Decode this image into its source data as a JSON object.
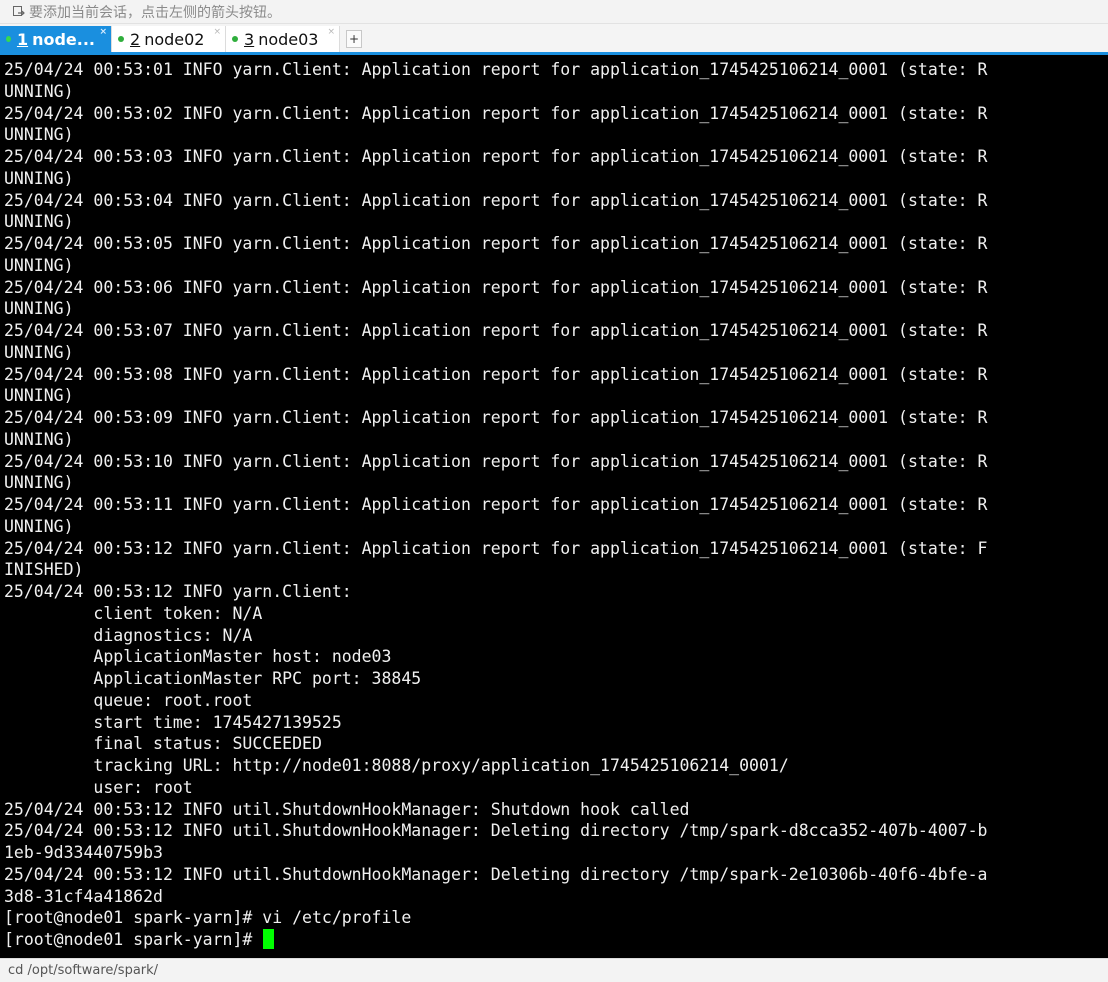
{
  "hint_bar": {
    "icon": "arrow-icon",
    "text": "要添加当前会话，点击左侧的箭头按钮。"
  },
  "tabs": [
    {
      "number": "1",
      "label": "node...",
      "status_color": "#36d94f",
      "active": true
    },
    {
      "number": "2",
      "label": "node02",
      "status_color": "#2fae3c",
      "active": false
    },
    {
      "number": "3",
      "label": "node03",
      "status_color": "#2fae3c",
      "active": false
    }
  ],
  "add_tab_label": "+",
  "terminal": {
    "lines": [
      "25/04/24 00:53:01 INFO yarn.Client: Application report for application_1745425106214_0001 (state: R",
      "UNNING)",
      "25/04/24 00:53:02 INFO yarn.Client: Application report for application_1745425106214_0001 (state: R",
      "UNNING)",
      "25/04/24 00:53:03 INFO yarn.Client: Application report for application_1745425106214_0001 (state: R",
      "UNNING)",
      "25/04/24 00:53:04 INFO yarn.Client: Application report for application_1745425106214_0001 (state: R",
      "UNNING)",
      "25/04/24 00:53:05 INFO yarn.Client: Application report for application_1745425106214_0001 (state: R",
      "UNNING)",
      "25/04/24 00:53:06 INFO yarn.Client: Application report for application_1745425106214_0001 (state: R",
      "UNNING)",
      "25/04/24 00:53:07 INFO yarn.Client: Application report for application_1745425106214_0001 (state: R",
      "UNNING)",
      "25/04/24 00:53:08 INFO yarn.Client: Application report for application_1745425106214_0001 (state: R",
      "UNNING)",
      "25/04/24 00:53:09 INFO yarn.Client: Application report for application_1745425106214_0001 (state: R",
      "UNNING)",
      "25/04/24 00:53:10 INFO yarn.Client: Application report for application_1745425106214_0001 (state: R",
      "UNNING)",
      "25/04/24 00:53:11 INFO yarn.Client: Application report for application_1745425106214_0001 (state: R",
      "UNNING)",
      "25/04/24 00:53:12 INFO yarn.Client: Application report for application_1745425106214_0001 (state: F",
      "INISHED)",
      "25/04/24 00:53:12 INFO yarn.Client: ",
      "\t client token: N/A",
      "\t diagnostics: N/A",
      "\t ApplicationMaster host: node03",
      "\t ApplicationMaster RPC port: 38845",
      "\t queue: root.root",
      "\t start time: 1745427139525",
      "\t final status: SUCCEEDED",
      "\t tracking URL: http://node01:8088/proxy/application_1745425106214_0001/",
      "\t user: root",
      "25/04/24 00:53:12 INFO util.ShutdownHookManager: Shutdown hook called",
      "25/04/24 00:53:12 INFO util.ShutdownHookManager: Deleting directory /tmp/spark-d8cca352-407b-4007-b",
      "1eb-9d33440759b3",
      "25/04/24 00:53:12 INFO util.ShutdownHookManager: Deleting directory /tmp/spark-2e10306b-40f6-4bfe-a",
      "3d8-31cf4a41862d",
      "[root@node01 spark-yarn]# vi /etc/profile"
    ],
    "prompt": "[root@node01 spark-yarn]# ",
    "cursor_color": "#00ff00"
  },
  "command_bar": {
    "text": "cd /opt/software/spark/"
  }
}
